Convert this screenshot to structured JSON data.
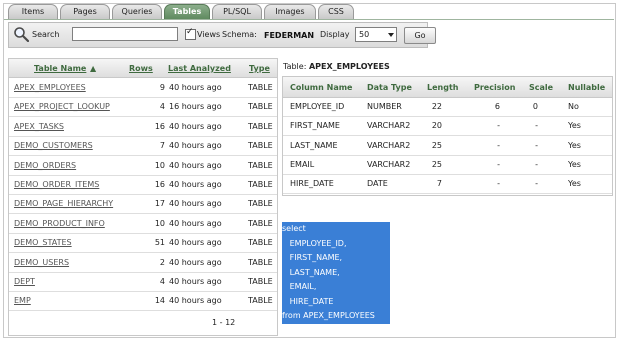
{
  "tabs": [
    {
      "label": "Items",
      "active": false
    },
    {
      "label": "Pages",
      "active": false
    },
    {
      "label": "Queries",
      "active": false
    },
    {
      "label": "Tables",
      "active": true
    },
    {
      "label": "PL/SQL",
      "active": false
    },
    {
      "label": "Images",
      "active": false
    },
    {
      "label": "CSS",
      "active": false
    }
  ],
  "toolbar": {
    "search_label": "Search",
    "search_value": "",
    "views_label": "Views",
    "views_checked": true,
    "schema_label": "Schema:",
    "schema_value": "FEDERMAN",
    "display_label": "Display",
    "display_value": "50",
    "go_label": "Go"
  },
  "tables_list": {
    "headers": {
      "name": "Table Name",
      "rows": "Rows",
      "last_analyzed": "Last Analyzed",
      "type": "Type"
    },
    "sort_indicator": "▲",
    "rows": [
      {
        "name": "APEX_EMPLOYEES",
        "rows": "9",
        "last_analyzed": "40 hours ago",
        "type": "TABLE"
      },
      {
        "name": "APEX_PROJECT_LOOKUP",
        "rows": "4",
        "last_analyzed": "16 hours ago",
        "type": "TABLE"
      },
      {
        "name": "APEX_TASKS",
        "rows": "16",
        "last_analyzed": "40 hours ago",
        "type": "TABLE"
      },
      {
        "name": "DEMO_CUSTOMERS",
        "rows": "7",
        "last_analyzed": "40 hours ago",
        "type": "TABLE"
      },
      {
        "name": "DEMO_ORDERS",
        "rows": "10",
        "last_analyzed": "40 hours ago",
        "type": "TABLE"
      },
      {
        "name": "DEMO_ORDER_ITEMS",
        "rows": "16",
        "last_analyzed": "40 hours ago",
        "type": "TABLE"
      },
      {
        "name": "DEMO_PAGE_HIERARCHY",
        "rows": "17",
        "last_analyzed": "40 hours ago",
        "type": "TABLE"
      },
      {
        "name": "DEMO_PRODUCT_INFO",
        "rows": "10",
        "last_analyzed": "40 hours ago",
        "type": "TABLE"
      },
      {
        "name": "DEMO_STATES",
        "rows": "51",
        "last_analyzed": "40 hours ago",
        "type": "TABLE"
      },
      {
        "name": "DEMO_USERS",
        "rows": "2",
        "last_analyzed": "40 hours ago",
        "type": "TABLE"
      },
      {
        "name": "DEPT",
        "rows": "4",
        "last_analyzed": "40 hours ago",
        "type": "TABLE"
      },
      {
        "name": "EMP",
        "rows": "14",
        "last_analyzed": "40 hours ago",
        "type": "TABLE"
      }
    ],
    "pager": "1 - 12"
  },
  "detail": {
    "label": "Table:",
    "table_name": "APEX_EMPLOYEES",
    "headers": {
      "column": "Column Name",
      "data_type": "Data Type",
      "length": "Length",
      "precision": "Precision",
      "scale": "Scale",
      "nullable": "Nullable"
    },
    "rows": [
      {
        "column": "EMPLOYEE_ID",
        "data_type": "NUMBER",
        "length": "22",
        "precision": "6",
        "scale": "0",
        "nullable": "No"
      },
      {
        "column": "FIRST_NAME",
        "data_type": "VARCHAR2",
        "length": "20",
        "precision": "-",
        "scale": "-",
        "nullable": "Yes"
      },
      {
        "column": "LAST_NAME",
        "data_type": "VARCHAR2",
        "length": "25",
        "precision": "-",
        "scale": "-",
        "nullable": "Yes"
      },
      {
        "column": "EMAIL",
        "data_type": "VARCHAR2",
        "length": "25",
        "precision": "-",
        "scale": "-",
        "nullable": "Yes"
      },
      {
        "column": "HIRE_DATE",
        "data_type": "DATE",
        "length": "7",
        "precision": "-",
        "scale": "-",
        "nullable": "Yes"
      }
    ]
  },
  "sql": {
    "lines": [
      "select",
      "   EMPLOYEE_ID,",
      "   FIRST_NAME,",
      "   LAST_NAME,",
      "   EMAIL,",
      "   HIRE_DATE",
      "from APEX_EMPLOYEES"
    ]
  },
  "colors": {
    "accent_tab": "#6f986f",
    "header_text": "#3f6a3f",
    "selection": "#3a7fd6"
  }
}
